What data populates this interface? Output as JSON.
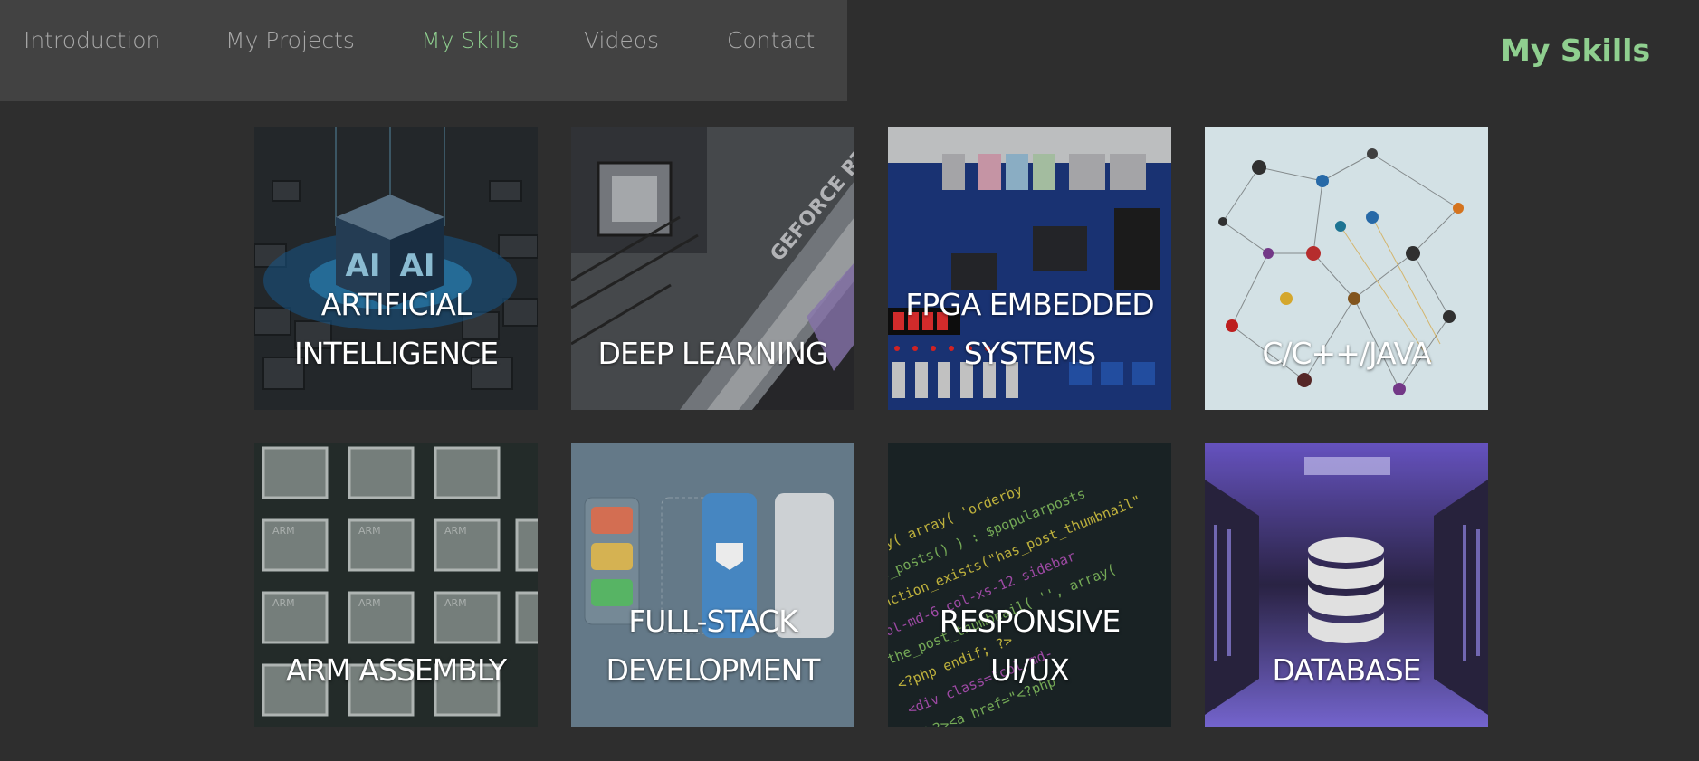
{
  "nav": {
    "items": [
      {
        "label": "Introduction"
      },
      {
        "label": "My Projects"
      },
      {
        "label": "My Skills"
      },
      {
        "label": "Videos"
      },
      {
        "label": "Contact"
      }
    ],
    "active_index": 2
  },
  "page": {
    "title": "My Skills"
  },
  "tiles": [
    {
      "lines": [
        "ARTIFICIAL",
        "INTELLIGENCE"
      ],
      "image": "ai-cube-image"
    },
    {
      "lines": [
        "DEEP LEARNING"
      ],
      "image": "gpu-image"
    },
    {
      "lines": [
        "FPGA EMBEDDED",
        "SYSTEMS"
      ],
      "image": "fpga-board-image"
    },
    {
      "lines": [
        "C/C++/JAVA"
      ],
      "image": "network-graph-image"
    },
    {
      "lines": [
        "ARM ASSEMBLY"
      ],
      "image": "arm-chips-image"
    },
    {
      "lines": [
        "FULL-STACK",
        "DEVELOPMENT"
      ],
      "image": "fullstack-image"
    },
    {
      "lines": [
        "RESPONSIVE",
        "UI/UX"
      ],
      "image": "code-screen-image"
    },
    {
      "lines": [
        "DATABASE"
      ],
      "image": "server-room-image"
    }
  ],
  "colors": {
    "accent": "#8fcf8f",
    "background": "#2e2e2e",
    "nav_bg": "#424242",
    "nav_text": "#a8a8a8"
  }
}
